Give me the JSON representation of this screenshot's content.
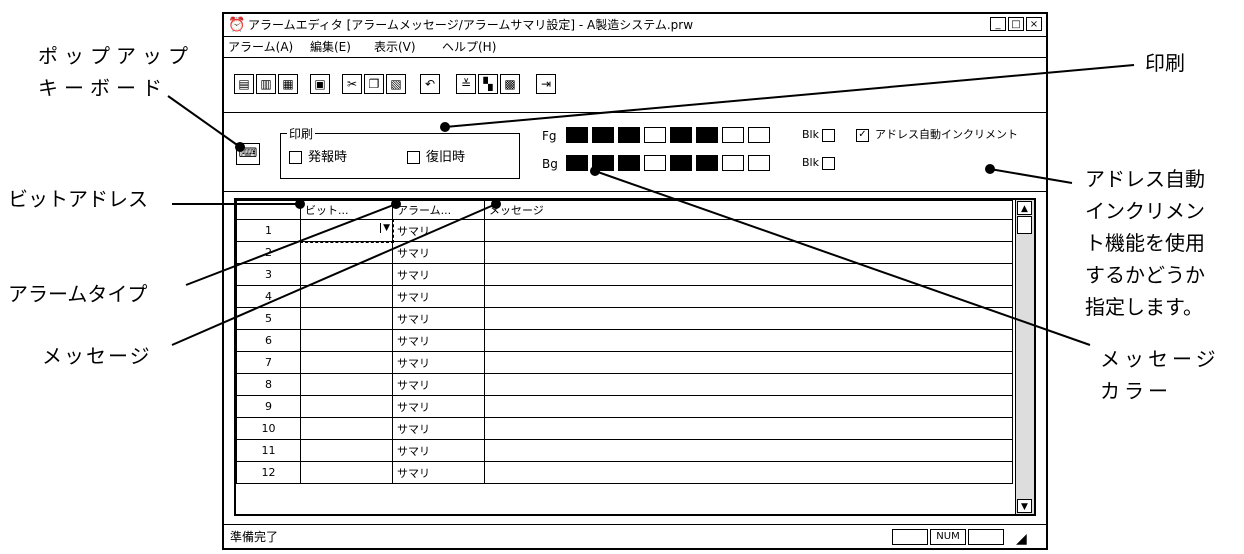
{
  "window": {
    "title": "アラームエディタ [アラームメッセージ/アラームサマリ設定] - A製造システム.prw",
    "controls": [
      "_",
      "□",
      "×"
    ]
  },
  "menu": [
    "アラーム(A)",
    "編集(E)",
    "表示(V)",
    "ヘルプ(H)"
  ],
  "toolbar_icons": [
    "view-list-icon",
    "view-detail-icon",
    "view-grid-icon",
    "save-icon",
    "cut-icon",
    "copy-icon",
    "paste-icon",
    "undo-icon",
    "import-icon",
    "layout-icon",
    "bitmap-icon",
    "exit-icon"
  ],
  "print_group": {
    "label": "印刷",
    "occur": {
      "label": "発報時",
      "checked": false
    },
    "restore": {
      "label": "復旧時",
      "checked": false
    }
  },
  "colors": {
    "fg_label": "Fg",
    "bg_label": "Bg",
    "fg": [
      "#000000",
      "#000000",
      "#000000",
      "#ffffff",
      "#000000",
      "#000000",
      "#ffffff",
      "#ffffff"
    ],
    "bg": [
      "#000000",
      "#000000",
      "#000000",
      "#ffffff",
      "#000000",
      "#000000",
      "#ffffff",
      "#ffffff"
    ],
    "blk_label": "Blk",
    "auto_increment_label": "アドレス自動インクリメント",
    "auto_increment_checked": true
  },
  "grid": {
    "headers": [
      "",
      "ビット...",
      "アラーム...",
      "メッセージ"
    ],
    "rows": [
      {
        "no": "1",
        "type": "サマリ"
      },
      {
        "no": "2",
        "type": "サマリ"
      },
      {
        "no": "3",
        "type": "サマリ"
      },
      {
        "no": "4",
        "type": "サマリ"
      },
      {
        "no": "5",
        "type": "サマリ"
      },
      {
        "no": "6",
        "type": "サマリ"
      },
      {
        "no": "7",
        "type": "サマリ"
      },
      {
        "no": "8",
        "type": "サマリ"
      },
      {
        "no": "9",
        "type": "サマリ"
      },
      {
        "no": "10",
        "type": "サマリ"
      },
      {
        "no": "11",
        "type": "サマリ"
      },
      {
        "no": "12",
        "type": "サマリ"
      }
    ]
  },
  "status": {
    "text": "準備完了",
    "num": "NUM"
  },
  "callouts": {
    "popup_keyboard": [
      "ポップアップ",
      "キーボード"
    ],
    "bit_address": "ビットアドレス",
    "alarm_type": "アラームタイプ",
    "message": "メッセージ",
    "print": "印刷",
    "auto_increment": [
      "アドレス自動",
      "インクリメン",
      "ト機能を使用",
      "するかどうか",
      "指定します。"
    ],
    "message_color": [
      "メッセージ",
      "カラー"
    ]
  }
}
